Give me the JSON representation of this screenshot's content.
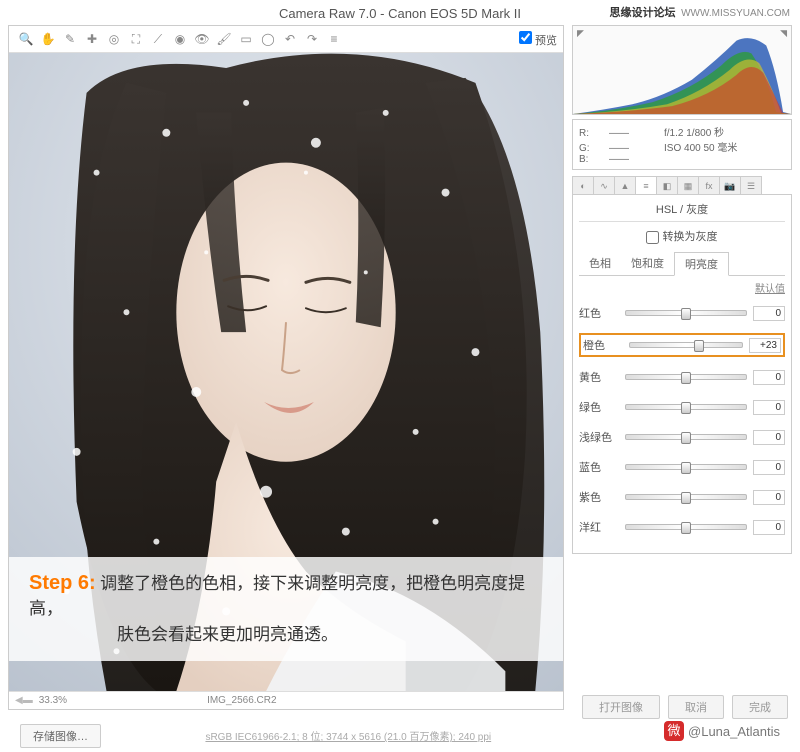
{
  "watermark_top": {
    "cn": "思缘设计论坛",
    "url": "WWW.MISSYUAN.COM"
  },
  "titlebar": "Camera Raw 7.0  -  Canon EOS 5D Mark II",
  "toolbar": {
    "icons": [
      "magnify",
      "hand",
      "eyedrop",
      "sample",
      "ruler",
      "crop",
      "straighten",
      "spot",
      "redeye",
      "adjust",
      "grad",
      "brush",
      "rotate-l",
      "rotate-r",
      "prefs"
    ],
    "preview_label": "预览"
  },
  "rgb": {
    "r": "R:",
    "g": "G:",
    "b": "B:",
    "vals": "——"
  },
  "exif": {
    "aperture": "f/1.2  1/800 秒",
    "iso": "ISO 400  50 毫米"
  },
  "panel": {
    "title": "HSL / 灰度",
    "grayscale": "转换为灰度",
    "tabs": {
      "hue": "色相",
      "sat": "饱和度",
      "lum": "明亮度"
    },
    "default_link": "默认值"
  },
  "sliders": {
    "red": {
      "label": "红色",
      "value": "0",
      "pos": 50
    },
    "orange": {
      "label": "橙色",
      "value": "+23",
      "pos": 62
    },
    "yellow": {
      "label": "黄色",
      "value": "0",
      "pos": 50
    },
    "green": {
      "label": "绿色",
      "value": "0",
      "pos": 50
    },
    "aqua": {
      "label": "浅绿色",
      "value": "0",
      "pos": 50
    },
    "blue": {
      "label": "蓝色",
      "value": "0",
      "pos": 50
    },
    "purple": {
      "label": "紫色",
      "value": "0",
      "pos": 50
    },
    "magenta": {
      "label": "洋红",
      "value": "0",
      "pos": 50
    }
  },
  "overlay": {
    "step": "Step 6:",
    "line1": "调整了橙色的色相，接下来调整明亮度，把橙色明亮度提高，",
    "line2": "肤色会看起来更加明亮通透。"
  },
  "status": {
    "zoom": "33.3%",
    "filename": "IMG_2566.CR2"
  },
  "save_button": "存储图像…",
  "color_profile": "sRGB IEC61966-2.1; 8 位; 3744 x 5616 (21.0 百万像素); 240 ppi",
  "bottom_buttons": {
    "open": "打开图像",
    "cancel": "取消",
    "done": "完成"
  },
  "credit": "@Luna_Atlantis"
}
